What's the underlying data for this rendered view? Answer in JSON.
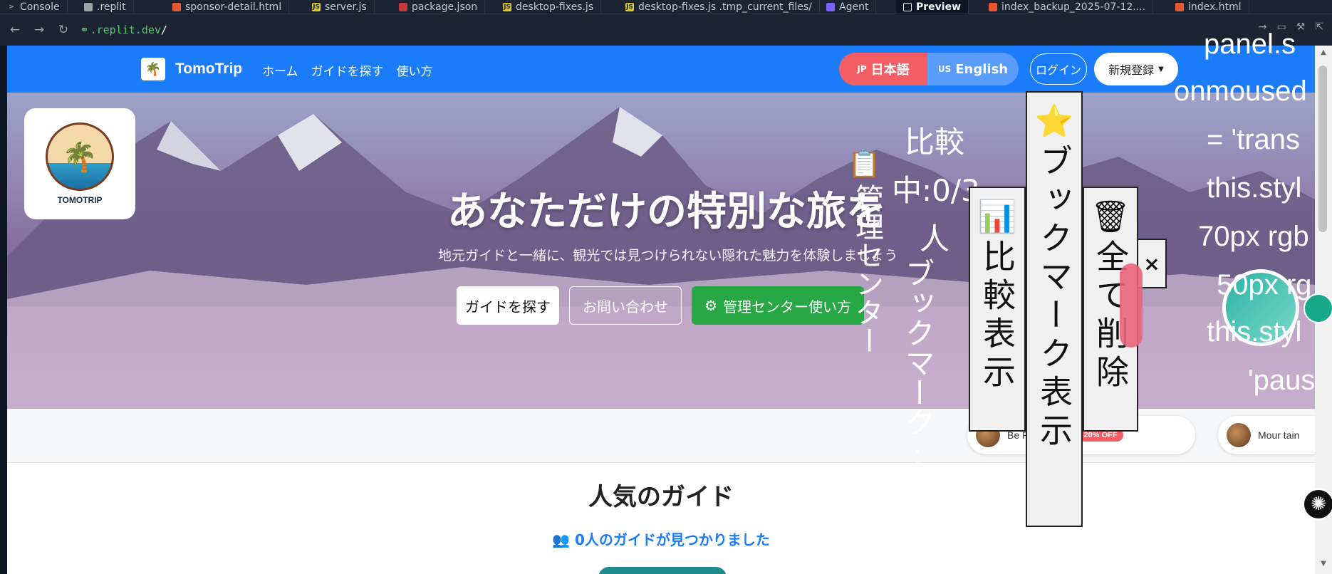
{
  "tabs": [
    {
      "label": "Console",
      "color": "#9da2a6"
    },
    {
      "label": ".replit",
      "color": "#9da2a6"
    },
    {
      "label": "sponsor-detail.html",
      "color": "#e4572e"
    },
    {
      "label": "server.js",
      "color": "#d9c534"
    },
    {
      "label": "package.json",
      "color": "#c4393b"
    },
    {
      "label": "desktop-fixes.js",
      "color": "#d9c534"
    },
    {
      "label": "desktop-fixes.js .tmp_current_files/",
      "color": "#d9c534"
    },
    {
      "label": "Agent",
      "color": "#7b61ff"
    },
    {
      "label": "Preview",
      "color": "#f5f9fc"
    },
    {
      "label": "index_backup_2025-07-12....",
      "color": "#e4572e"
    },
    {
      "label": "index.html",
      "color": "#e4572e"
    }
  ],
  "address": {
    "host": ".replit.dev",
    "path": "/"
  },
  "navbar": {
    "brand": "TomoTrip",
    "links": [
      "ホーム",
      "ガイドを探す",
      "使い方"
    ],
    "lang_jp_flag": "JP",
    "lang_jp": "日本語",
    "lang_en_flag": "US",
    "lang_en": "English",
    "login": "ログイン",
    "signup": "新規登録"
  },
  "hero": {
    "logo_label": "TOMOTRIP",
    "title": "あなただけの特別な旅を",
    "subtitle": "地元ガイドと一緒に、観光では見つけられない隠れた魅力を体験しましょう",
    "btn_find": "ガイドを探す",
    "btn_contact": "お問い合わせ",
    "btn_admin": "管理センター使い方"
  },
  "sponsors": [
    {
      "name": "Be  Restaurant",
      "badge": "20% OFF"
    },
    {
      "name": "Mour tain",
      "badge": ""
    }
  ],
  "guides": {
    "title": "人気のガイド",
    "found": "0人のガイドが見つかりました"
  },
  "overlay": {
    "admin_center": "管理センター",
    "compare_status": "比較中:0/3人",
    "bookmark_status": "ブックマーク:0",
    "compare_btn": "比較表示",
    "bookmark_btn": "ブックマーク表示",
    "delete_btn": "全て削除",
    "close": "×",
    "code_lines": [
      "panel.s",
      "onmoused",
      "= 'trans",
      "this.styl",
      "70px rgb",
      "50px rg",
      "this.styl",
      "'paus"
    ]
  },
  "colors": {
    "accent": "#1a7cf8",
    "jp_pill": "#f25e63",
    "admin_green": "#28a745"
  }
}
